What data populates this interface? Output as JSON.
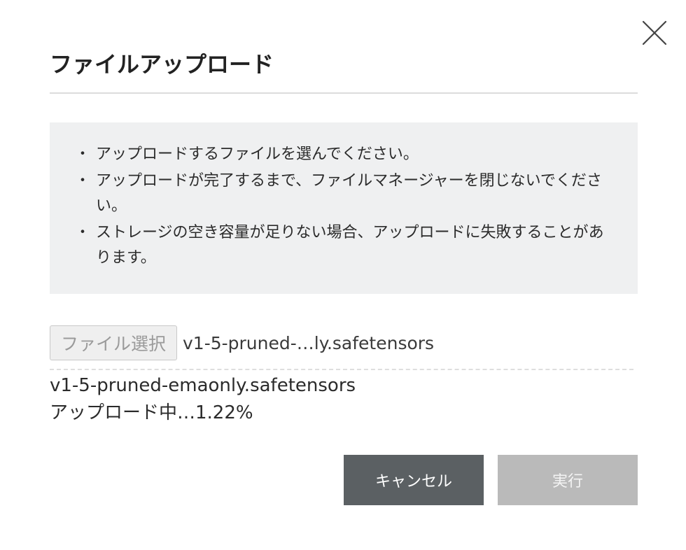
{
  "dialog": {
    "title": "ファイルアップロード",
    "close_icon": "close-icon"
  },
  "notice": {
    "bullet": "・",
    "items": [
      "アップロードするファイルを選んでください。",
      "アップロードが完了するまで、ファイルマネージャーを閉じないでください。",
      "ストレージの空き容量が足りない場合、アップロードに失敗することがあります。"
    ]
  },
  "file_input": {
    "button_label": "ファイル選択",
    "selected_file_display": "v1-5-pruned-…ly.safetensors"
  },
  "upload": {
    "file_name": "v1-5-pruned-emaonly.safetensors",
    "status": "アップロード中…1.22%"
  },
  "actions": {
    "cancel_label": "キャンセル",
    "run_label": "実行"
  },
  "colors": {
    "notice_background": "#eff0f1",
    "cancel_button": "#5b6063",
    "run_button_disabled": "#bababa"
  }
}
